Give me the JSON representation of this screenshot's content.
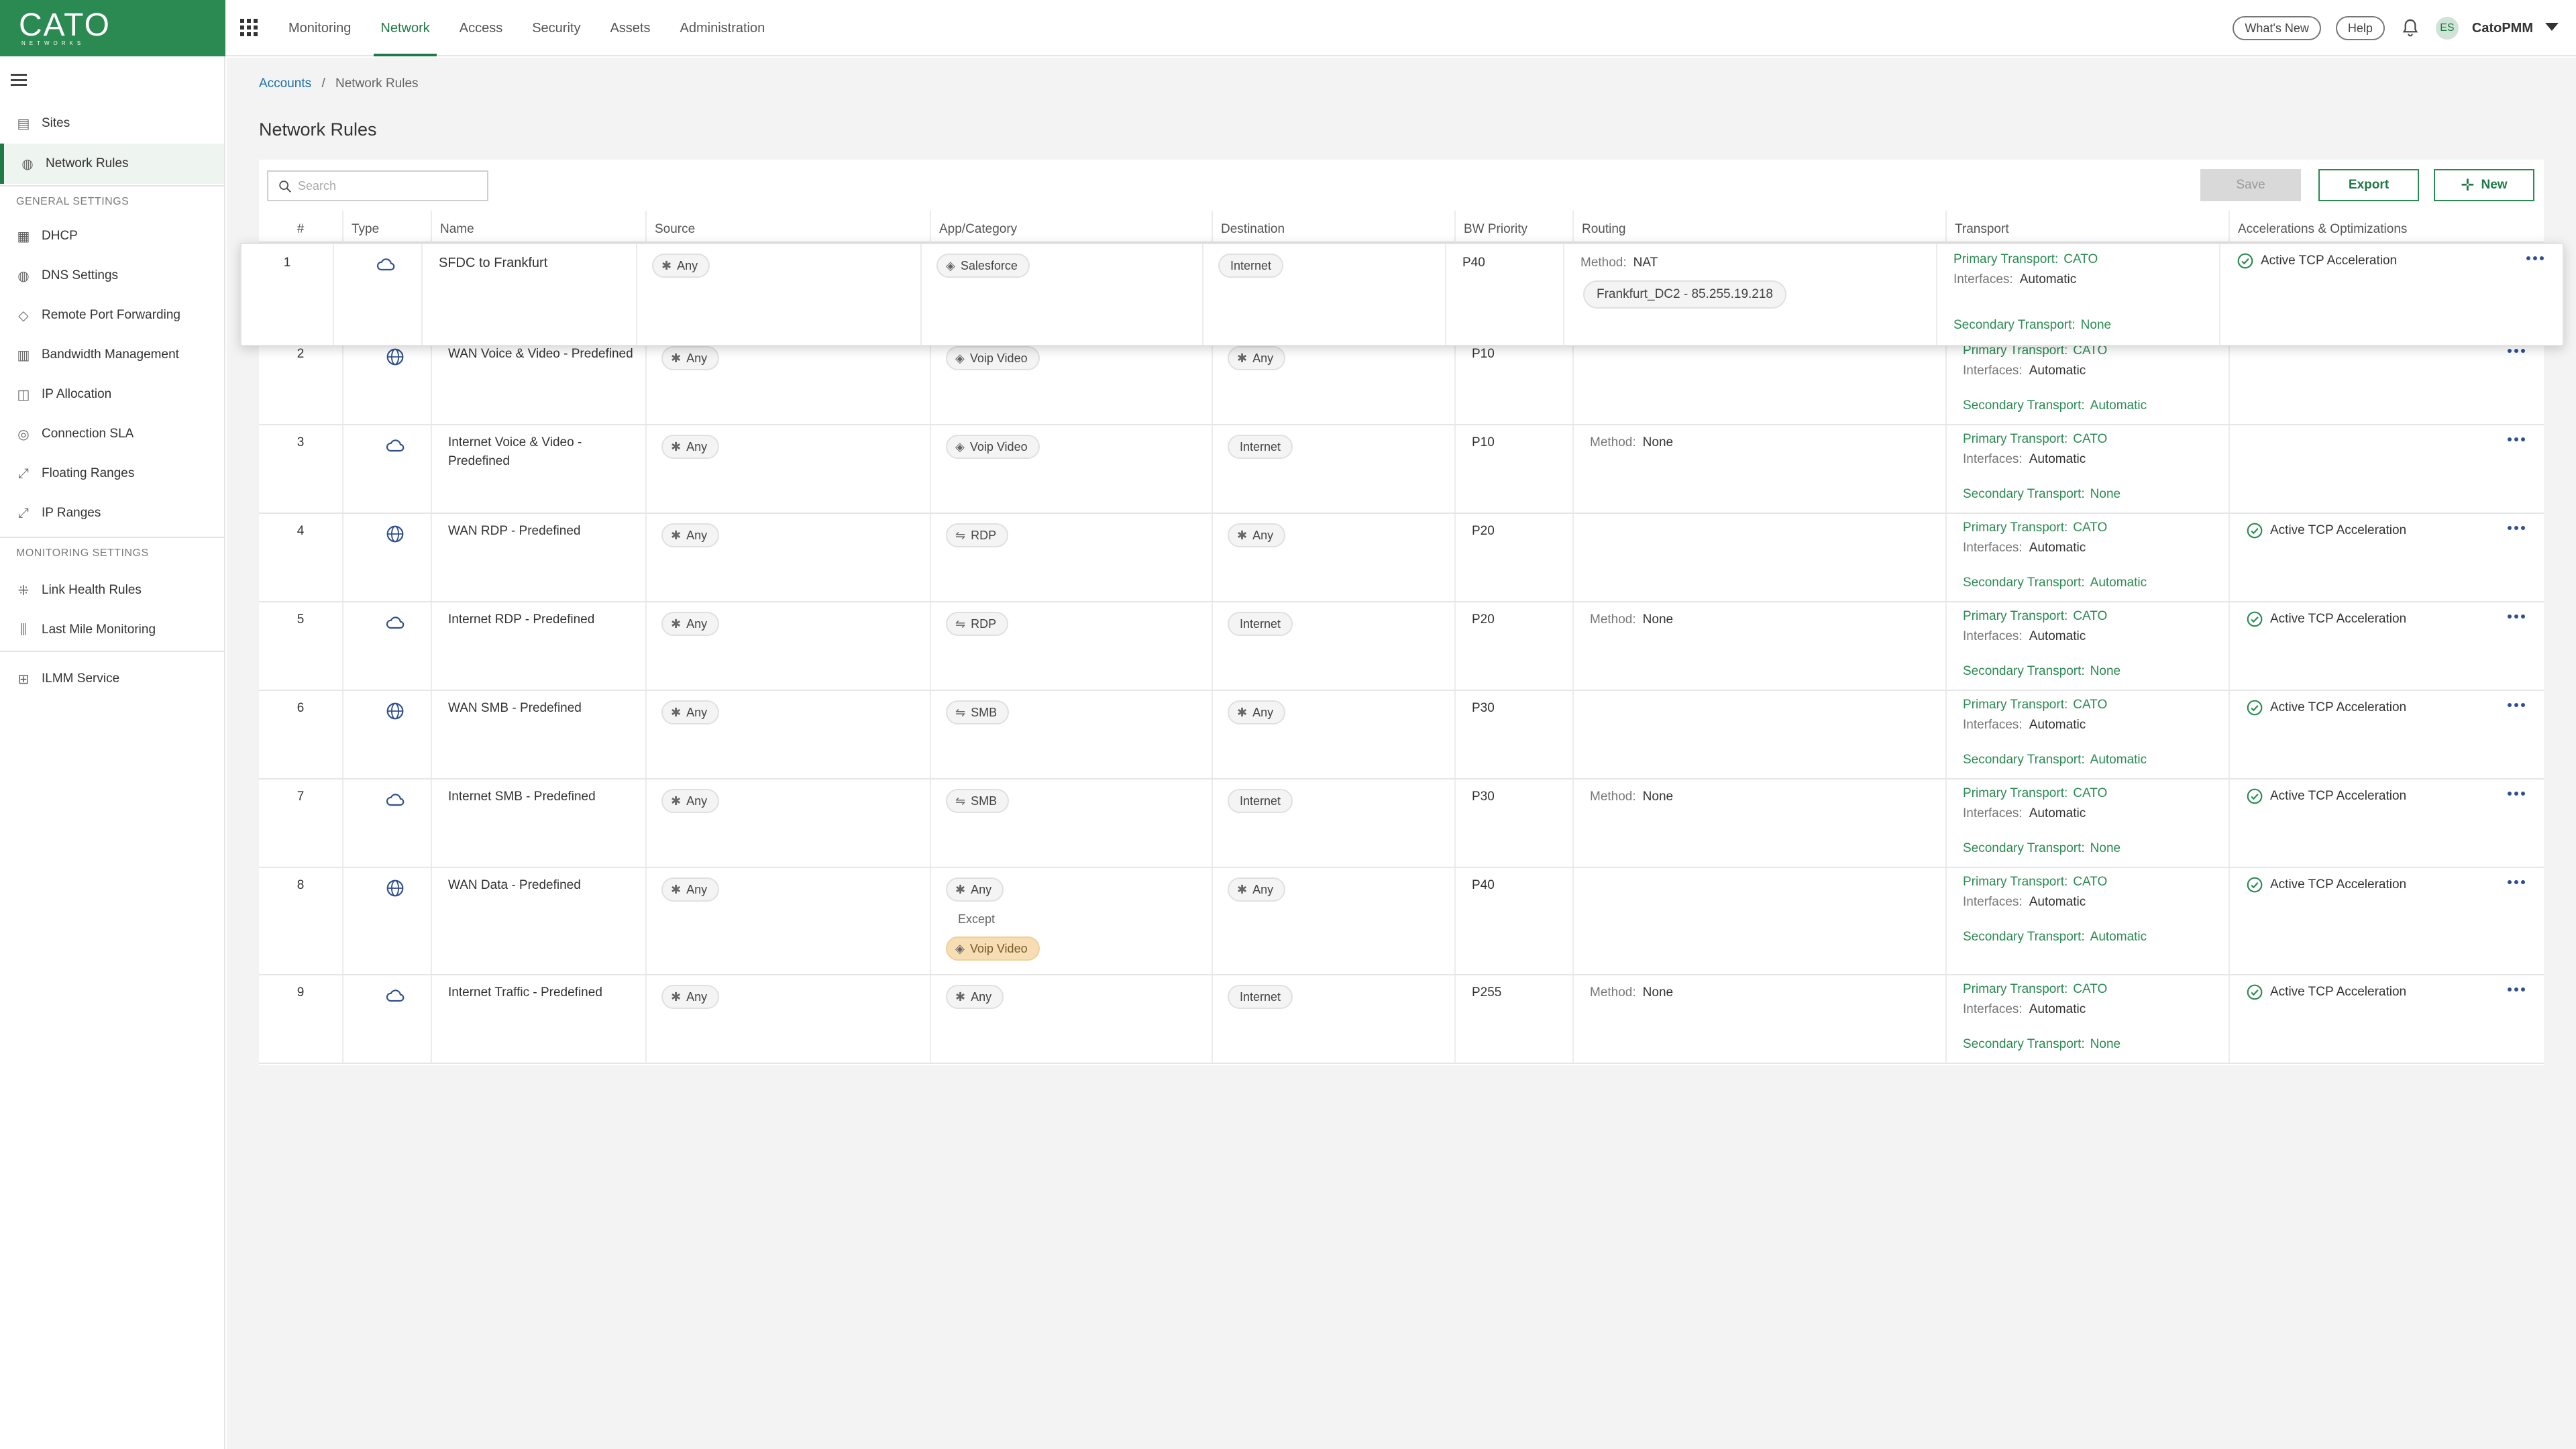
{
  "app": {
    "logo": "CATO",
    "logo_sub": "NETWORKS",
    "nav": [
      "Monitoring",
      "Network",
      "Access",
      "Security",
      "Assets",
      "Administration"
    ],
    "active_nav": "Network",
    "whats_new": "What's New",
    "help": "Help",
    "avatar_initials": "ES",
    "account": "CatoPMM"
  },
  "sidebar": {
    "items": [
      {
        "label": "Sites",
        "icon": "sites-icon"
      },
      {
        "label": "Network Rules",
        "icon": "globe-icon",
        "active": true
      }
    ],
    "general_header": "GENERAL SETTINGS",
    "general_items": [
      {
        "label": "DHCP",
        "icon": "dhcp-icon"
      },
      {
        "label": "DNS Settings",
        "icon": "dns-icon"
      },
      {
        "label": "Remote Port Forwarding",
        "icon": "port-forward-icon"
      },
      {
        "label": "Bandwidth Management",
        "icon": "bandwidth-icon"
      },
      {
        "label": "IP Allocation",
        "icon": "ip-allocation-icon"
      },
      {
        "label": "Connection SLA",
        "icon": "sla-icon"
      },
      {
        "label": "Floating Ranges",
        "icon": "floating-range-icon"
      },
      {
        "label": "IP Ranges",
        "icon": "ip-range-icon"
      }
    ],
    "monitoring_header": "MONITORING SETTINGS",
    "monitoring_items": [
      {
        "label": "Link Health Rules",
        "icon": "link-health-icon"
      },
      {
        "label": "Last Mile Monitoring",
        "icon": "last-mile-icon"
      }
    ],
    "other_items": [
      {
        "label": "ILMM Service",
        "icon": "ilmm-icon"
      }
    ]
  },
  "breadcrumb": {
    "parent": "Accounts",
    "separator": "/",
    "current": "Network Rules"
  },
  "page_title": "Network Rules",
  "toolbar": {
    "search_placeholder": "Search",
    "save": "Save",
    "export": "Export",
    "new": "New"
  },
  "table": {
    "columns": [
      "#",
      "Type",
      "Name",
      "Source",
      "App/Category",
      "Destination",
      "BW Priority",
      "Routing",
      "Transport",
      "Accelerations & Optimizations"
    ],
    "labels": {
      "method": "Method:",
      "primary": "Primary Transport:",
      "interfaces": "Interfaces:",
      "secondary": "Secondary Transport:",
      "except": "Except"
    },
    "rows": [
      {
        "num": "1",
        "type": "cloud",
        "name": "SFDC to Frankfurt",
        "source": "Any",
        "app": "Salesforce",
        "app_icon": "app",
        "dest": "Internet",
        "dest_kind": "plain",
        "bw": "P40",
        "method": "NAT",
        "route_chip": "Frankfurt_DC2 - 85.255.19.218",
        "primary": "CATO",
        "interfaces": "Automatic",
        "secondary": "None",
        "accel": "Active TCP Acceleration"
      },
      {
        "num": "2",
        "type": "globe",
        "name": "WAN Voice & Video - Predefined",
        "source": "Any",
        "app": "Voip Video",
        "app_icon": "app",
        "dest": "Any",
        "dest_kind": "any",
        "bw": "P10",
        "method": "",
        "primary": "CATO",
        "interfaces": "Automatic",
        "secondary": "Automatic",
        "accel": ""
      },
      {
        "num": "3",
        "type": "cloud",
        "name": "Internet Voice & Video - Predefined",
        "source": "Any",
        "app": "Voip Video",
        "app_icon": "app",
        "dest": "Internet",
        "dest_kind": "plain",
        "bw": "P10",
        "method": "None",
        "primary": "CATO",
        "interfaces": "Automatic",
        "secondary": "None",
        "accel": ""
      },
      {
        "num": "4",
        "type": "globe",
        "name": "WAN RDP - Predefined",
        "source": "Any",
        "app": "RDP",
        "app_icon": "proto",
        "dest": "Any",
        "dest_kind": "any",
        "bw": "P20",
        "method": "",
        "primary": "CATO",
        "interfaces": "Automatic",
        "secondary": "Automatic",
        "accel": "Active TCP Acceleration"
      },
      {
        "num": "5",
        "type": "cloud",
        "name": "Internet RDP - Predefined",
        "source": "Any",
        "app": "RDP",
        "app_icon": "proto",
        "dest": "Internet",
        "dest_kind": "plain",
        "bw": "P20",
        "method": "None",
        "primary": "CATO",
        "interfaces": "Automatic",
        "secondary": "None",
        "accel": "Active TCP Acceleration"
      },
      {
        "num": "6",
        "type": "globe",
        "name": "WAN SMB - Predefined",
        "source": "Any",
        "app": "SMB",
        "app_icon": "proto",
        "dest": "Any",
        "dest_kind": "any",
        "bw": "P30",
        "method": "",
        "primary": "CATO",
        "interfaces": "Automatic",
        "secondary": "Automatic",
        "accel": "Active TCP Acceleration"
      },
      {
        "num": "7",
        "type": "cloud",
        "name": "Internet SMB - Predefined",
        "source": "Any",
        "app": "SMB",
        "app_icon": "proto",
        "dest": "Internet",
        "dest_kind": "plain",
        "bw": "P30",
        "method": "None",
        "primary": "CATO",
        "interfaces": "Automatic",
        "secondary": "None",
        "accel": "Active TCP Acceleration"
      },
      {
        "num": "8",
        "type": "globe",
        "name": "WAN Data - Predefined",
        "source": "Any",
        "app": "Any",
        "app_icon": "any",
        "app_except": "Voip Video",
        "dest": "Any",
        "dest_kind": "any",
        "bw": "P40",
        "method": "",
        "primary": "CATO",
        "interfaces": "Automatic",
        "secondary": "Automatic",
        "accel": "Active TCP Acceleration"
      },
      {
        "num": "9",
        "type": "cloud",
        "name": "Internet Traffic - Predefined",
        "source": "Any",
        "app": "Any",
        "app_icon": "any",
        "dest": "Internet",
        "dest_kind": "plain",
        "bw": "P255",
        "method": "None",
        "primary": "CATO",
        "interfaces": "Automatic",
        "secondary": "None",
        "accel": "Active TCP Acceleration"
      }
    ]
  }
}
